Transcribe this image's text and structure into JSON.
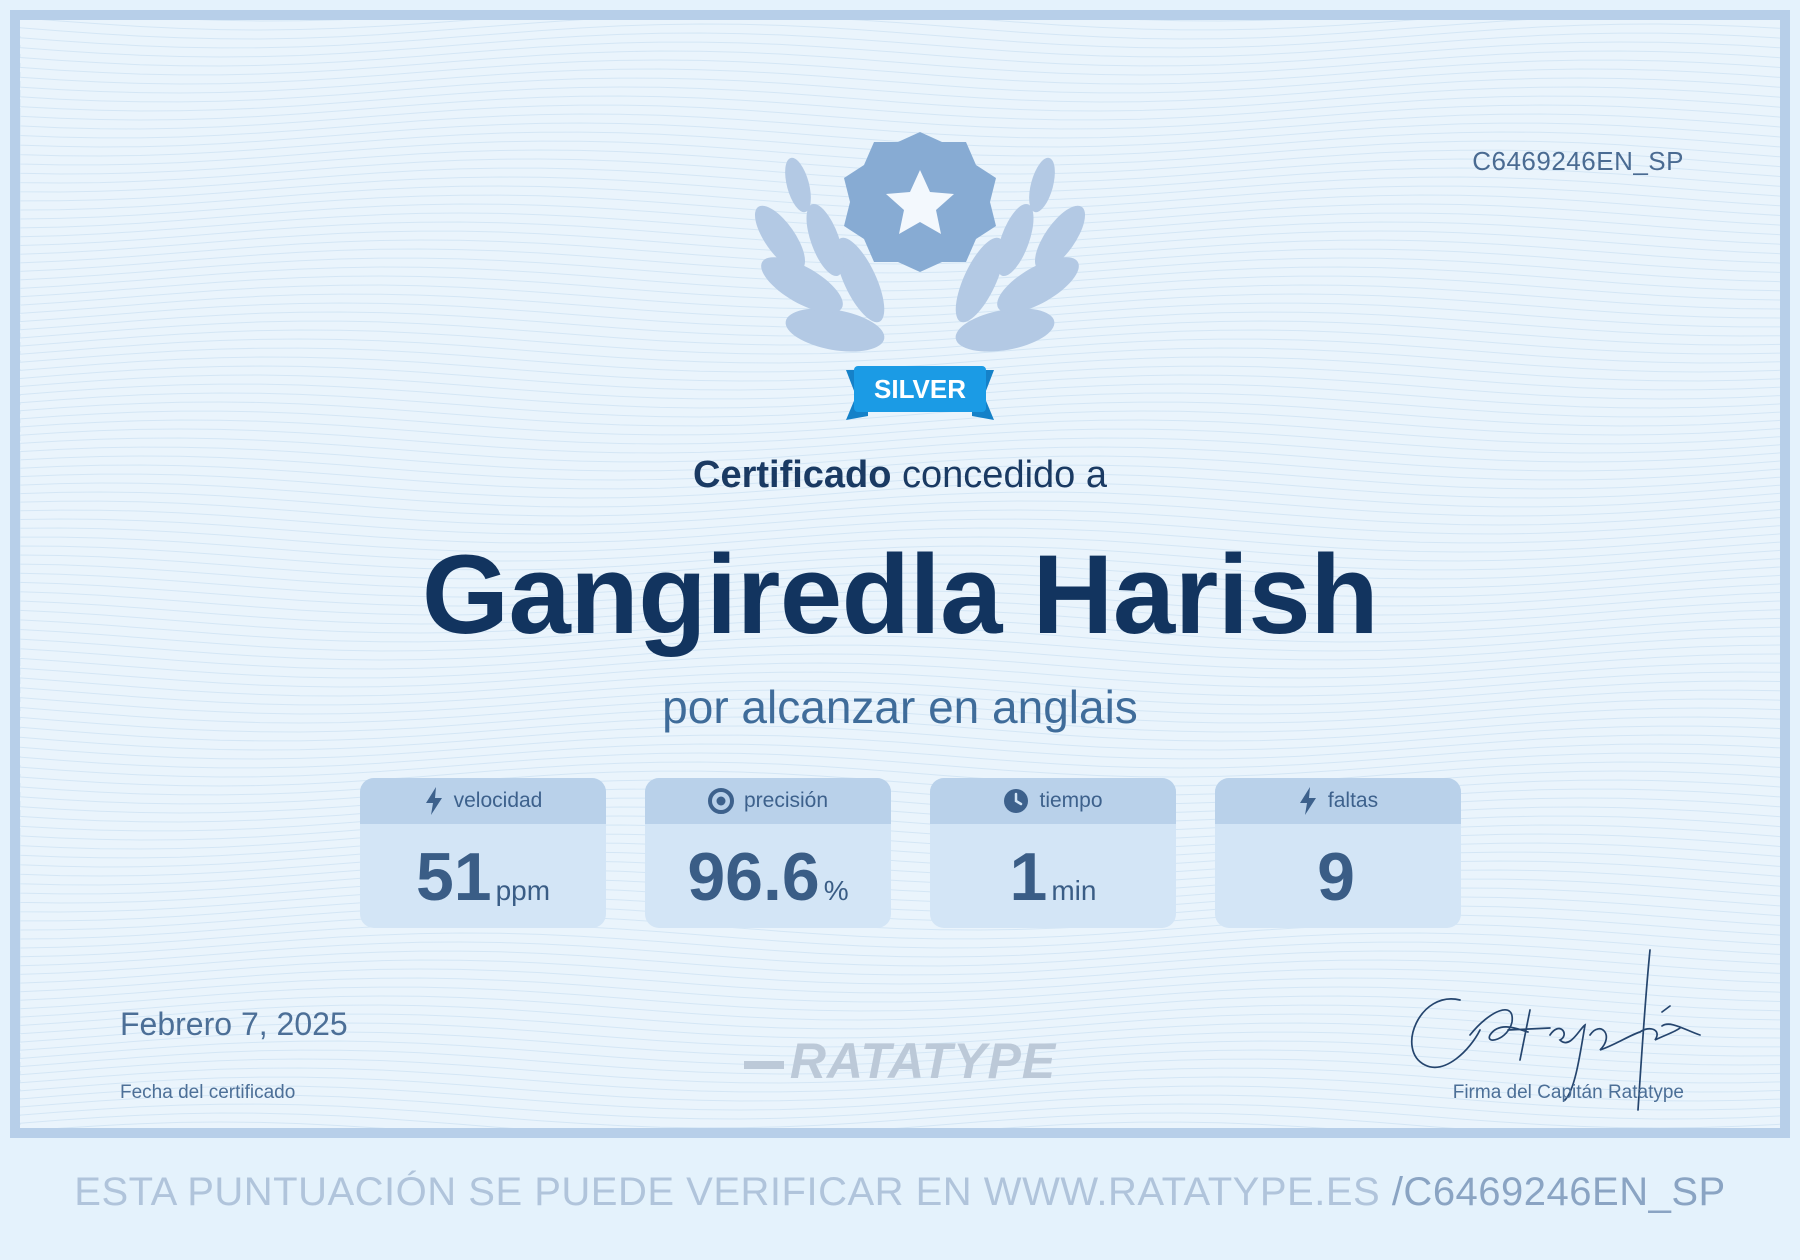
{
  "certificate": {
    "code": "C6469246EN_SP",
    "badge": "SILVER",
    "title_bold": "Certificado",
    "title_rest": " concedido a",
    "name": "Gangiredla Harish",
    "subtitle": "por alcanzar en anglais",
    "stats": [
      {
        "label": "velocidad",
        "value": "51",
        "unit": "ppm",
        "icon": "lightning-icon"
      },
      {
        "label": "precisión",
        "value": "96.6",
        "unit": "%",
        "icon": "target-icon"
      },
      {
        "label": "tiempo",
        "value": "1",
        "unit": "min",
        "icon": "clock-icon"
      },
      {
        "label": "faltas",
        "value": "9",
        "unit": "",
        "icon": "lightning-icon"
      }
    ],
    "date": "Febrero 7, 2025",
    "date_label": "Fecha del certificado",
    "logo": "RATATYPE",
    "signature_label": "Firma del Capitán Ratatype"
  },
  "footer": {
    "text": "ESTA PUNTUACIÓN SE PUEDE VERIFICAR EN WWW.RATATYPE.ES ",
    "code": "/C6469246EN_SP"
  },
  "colors": {
    "background": "#eaf4fc",
    "border": "#b7cfe9",
    "name": "#12345f",
    "badge": "#1b9be5"
  }
}
